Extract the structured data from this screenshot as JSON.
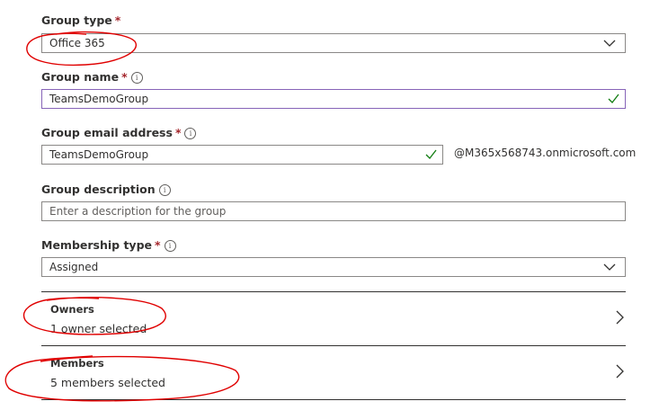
{
  "form": {
    "group_type": {
      "label": "Group type",
      "required_mark": "*",
      "value": "Office 365"
    },
    "group_name": {
      "label": "Group name",
      "required_mark": "*",
      "info_icon": "i",
      "value": "TeamsDemoGroup"
    },
    "group_email": {
      "label": "Group email address",
      "required_mark": "*",
      "info_icon": "i",
      "value": "TeamsDemoGroup",
      "domain_suffix": "@M365x568743.onmicrosoft.com"
    },
    "group_description": {
      "label": "Group description",
      "info_icon": "i",
      "placeholder": "Enter a description for the group"
    },
    "membership_type": {
      "label": "Membership type",
      "required_mark": "*",
      "info_icon": "i",
      "value": "Assigned"
    },
    "owners": {
      "title": "Owners",
      "value": "1 owner selected"
    },
    "members": {
      "title": "Members",
      "value": "5 members selected"
    }
  },
  "icons": {
    "dropdown": "chevron-down-icon",
    "valid": "checkmark-icon",
    "navigate": "chevron-right-icon",
    "info": "info-icon"
  },
  "colors": {
    "required": "#a4262c",
    "valid_check": "#107c10",
    "focus_border": "#8764b8",
    "annotation": "#e00000"
  }
}
